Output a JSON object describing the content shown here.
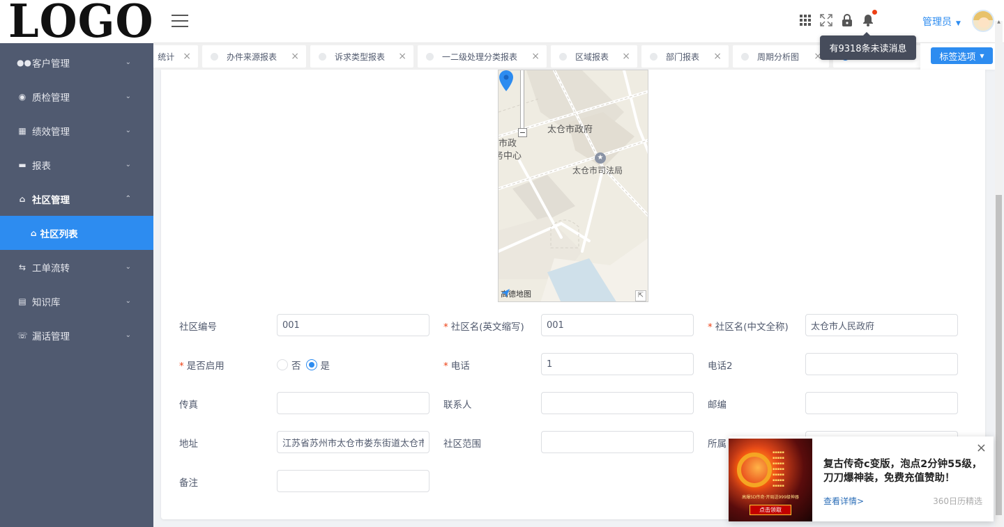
{
  "logo": "LOGO",
  "sidebar": {
    "items": [
      {
        "label": "客户管理",
        "icon": "users-icon"
      },
      {
        "label": "质检管理",
        "icon": "alert-icon"
      },
      {
        "label": "绩效管理",
        "icon": "chart-icon"
      },
      {
        "label": "报表",
        "icon": "folder-icon"
      },
      {
        "label": "社区管理",
        "icon": "home-icon"
      },
      {
        "label": "工单流转",
        "icon": "flow-icon"
      },
      {
        "label": "知识库",
        "icon": "book-icon"
      },
      {
        "label": "漏话管理",
        "icon": "phone-icon"
      }
    ],
    "sub_item": "社区列表"
  },
  "header": {
    "admin": "管理员",
    "tooltip": "有9318条未读消息"
  },
  "tabs": [
    "统计",
    "办件来源报表",
    "诉求类型报表",
    "一二级处理分类报表",
    "区域报表",
    "部门报表",
    "周期分析图"
  ],
  "tab_options": "标签选项",
  "map": {
    "labels": [
      "太仓市政府",
      "太仓市司法局",
      "市政",
      "务中心"
    ],
    "provider": "高德地图"
  },
  "form": {
    "code_label": "社区编号",
    "code_value": "001",
    "abbr_label": "社区名(英文缩写)",
    "abbr_value": "001",
    "fullname_label": "社区名(中文全称)",
    "fullname_value": "太仓市人民政府",
    "enabled_label": "是否启用",
    "enabled_no": "否",
    "enabled_yes": "是",
    "phone_label": "电话",
    "phone_value": "1",
    "phone2_label": "电话2",
    "phone2_value": "",
    "fax_label": "传真",
    "fax_value": "",
    "contact_label": "联系人",
    "contact_value": "",
    "postcode_label": "邮编",
    "postcode_value": "",
    "address_label": "地址",
    "address_value": "江苏省苏州市太仓市娄东街道太仓市人民政府",
    "range_label": "社区范围",
    "range_value": "",
    "belong_label": "所属",
    "remark_label": "备注",
    "remark_value": ""
  },
  "ad": {
    "title": "复古传奇c变版，泡点2分钟55级，刀刀爆神装，免费充值赞助！",
    "link": "查看详情>",
    "source": "360日历精选",
    "image_button": "点击领取",
    "image_promo": "高爆5D传奇·开局送999级神器"
  }
}
